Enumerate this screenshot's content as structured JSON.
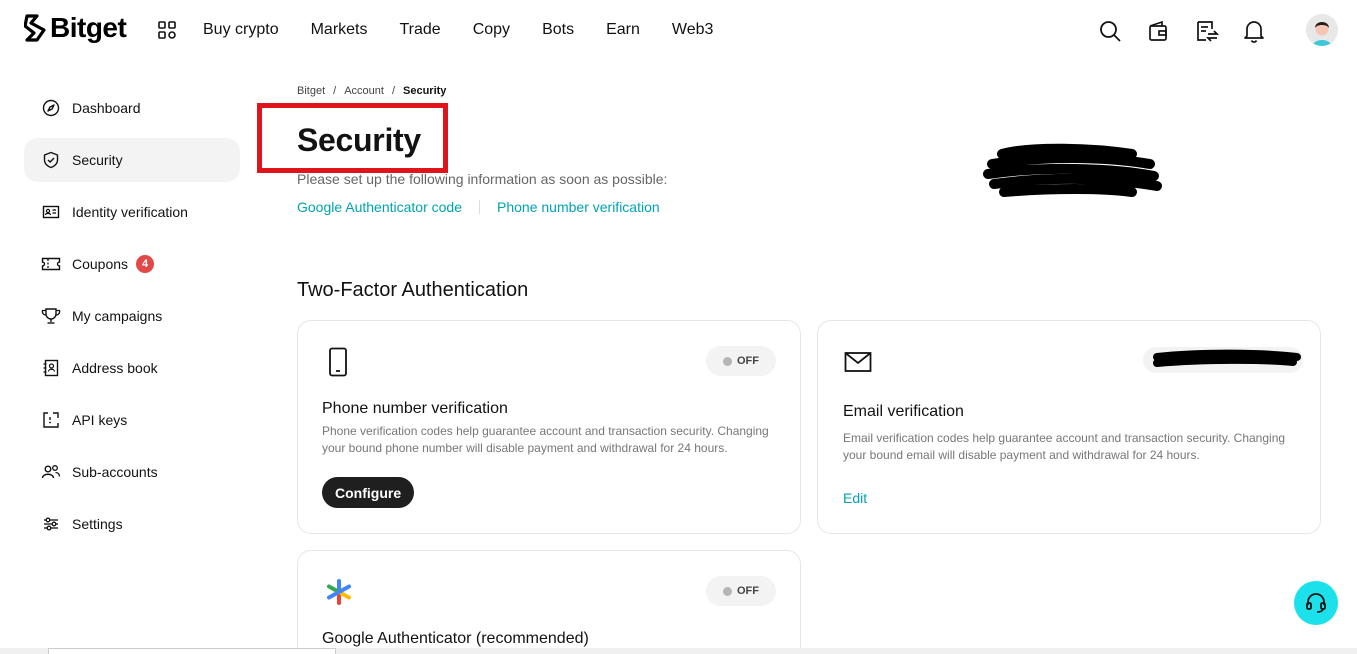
{
  "brand": {
    "name": "Bitget"
  },
  "nav": {
    "items": [
      "Buy crypto",
      "Markets",
      "Trade",
      "Copy",
      "Bots",
      "Earn",
      "Web3"
    ]
  },
  "header_icons": [
    "search-icon",
    "wallet-icon",
    "orders-icon",
    "bell-icon"
  ],
  "sidebar": {
    "items": [
      {
        "label": "Dashboard",
        "icon": "compass-icon"
      },
      {
        "label": "Security",
        "icon": "shield-icon",
        "active": true
      },
      {
        "label": "Identity verification",
        "icon": "id-card-icon"
      },
      {
        "label": "Coupons",
        "icon": "ticket-icon",
        "badge": "4"
      },
      {
        "label": "My campaigns",
        "icon": "trophy-icon"
      },
      {
        "label": "Address book",
        "icon": "address-book-icon"
      },
      {
        "label": "API keys",
        "icon": "api-icon"
      },
      {
        "label": "Sub-accounts",
        "icon": "users-icon"
      },
      {
        "label": "Settings",
        "icon": "sliders-icon"
      }
    ]
  },
  "breadcrumb": {
    "items": [
      "Bitget",
      "Account",
      "Security"
    ]
  },
  "page": {
    "title": "Security",
    "subtitle": "Please set up the following information as soon as possible:",
    "quick_links": [
      "Google Authenticator code",
      "Phone number verification"
    ]
  },
  "two_factor": {
    "section_title": "Two-Factor Authentication",
    "cards": [
      {
        "title": "Phone number verification",
        "description": "Phone verification codes help guarantee account and transaction security. Changing your bound phone number will disable payment and withdrawal for 24 hours.",
        "status": "OFF",
        "action": "Configure",
        "icon": "phone-icon"
      },
      {
        "title": "Email verification",
        "description": "Email verification codes help guarantee account and transaction security. Changing your bound email will disable payment and withdrawal for 24 hours.",
        "action": "Edit",
        "icon": "mail-icon"
      },
      {
        "title": "Google Authenticator (recommended)",
        "status": "OFF",
        "icon": "google-authenticator-icon"
      }
    ]
  },
  "colors": {
    "accent": "#00a3b4",
    "highlight": "#e0151b",
    "badge": "#e34848",
    "support": "#1de1ea"
  }
}
